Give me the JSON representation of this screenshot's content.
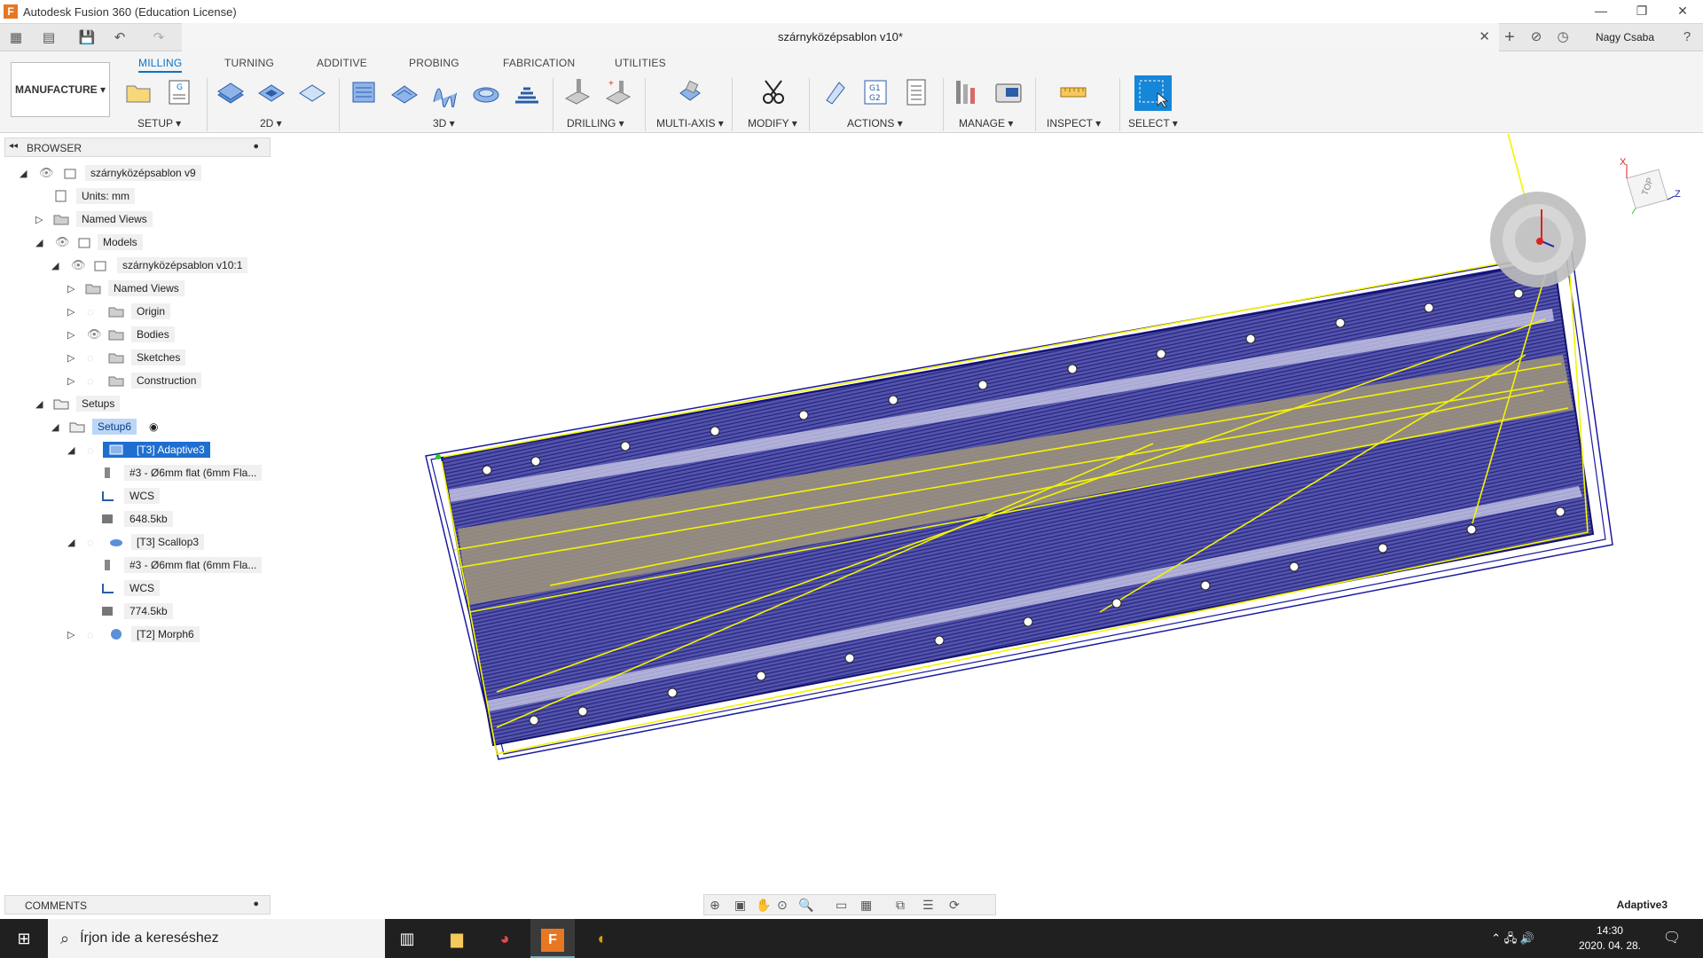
{
  "window": {
    "title": "Autodesk Fusion 360 (Education License)",
    "minimize": "—",
    "restore": "❐",
    "close": "✕"
  },
  "quickbar": {
    "grid": "▦",
    "file": "▤",
    "save": "💾",
    "undo": "↶",
    "redo": "↷",
    "add": "+",
    "ext": "⊘",
    "clock": "◷",
    "help": "?",
    "user": "Nagy Csaba"
  },
  "doc": {
    "title": "szárnyközépsablon v10*",
    "close": "✕"
  },
  "ribbon": {
    "workspace": "MANUFACTURE ▾",
    "tabs": [
      "MILLING",
      "TURNING",
      "ADDITIVE",
      "PROBING",
      "FABRICATION",
      "UTILITIES"
    ],
    "groups": [
      "SETUP ▾",
      "2D ▾",
      "3D ▾",
      "DRILLING ▾",
      "MULTI-AXIS ▾",
      "MODIFY ▾",
      "ACTIONS ▾",
      "MANAGE ▾",
      "INSPECT ▾",
      "SELECT ▾"
    ],
    "gcode_label": "G1\nG2"
  },
  "browser": {
    "header": "BROWSER",
    "rows": [
      {
        "label": "szárnyközépsablon v9"
      },
      {
        "label": "Units: mm"
      },
      {
        "label": "Named Views"
      },
      {
        "label": "Models"
      },
      {
        "label": "szárnyközépsablon v10:1"
      },
      {
        "label": "Named Views"
      },
      {
        "label": "Origin"
      },
      {
        "label": "Bodies"
      },
      {
        "label": "Sketches"
      },
      {
        "label": "Construction"
      },
      {
        "label": "Setups"
      },
      {
        "label": "Setup6"
      },
      {
        "label": "[T3] Adaptive3"
      },
      {
        "label": "#3 - Ø6mm flat (6mm Fla..."
      },
      {
        "label": "WCS"
      },
      {
        "label": "648.5kb"
      },
      {
        "label": "[T3] Scallop3"
      },
      {
        "label": "#3 - Ø6mm flat (6mm Fla..."
      },
      {
        "label": "WCS"
      },
      {
        "label": "774.5kb"
      },
      {
        "label": "[T2] Morph6"
      }
    ]
  },
  "viewcube": {
    "face": "TOP",
    "x": "X",
    "z": "Z"
  },
  "comments": {
    "header": "COMMENTS"
  },
  "status": {
    "active_operation": "Adaptive3"
  },
  "taskbar": {
    "search_placeholder": "Írjon ide a kereséshez",
    "time": "14:30",
    "date": "2020. 04. 28."
  }
}
